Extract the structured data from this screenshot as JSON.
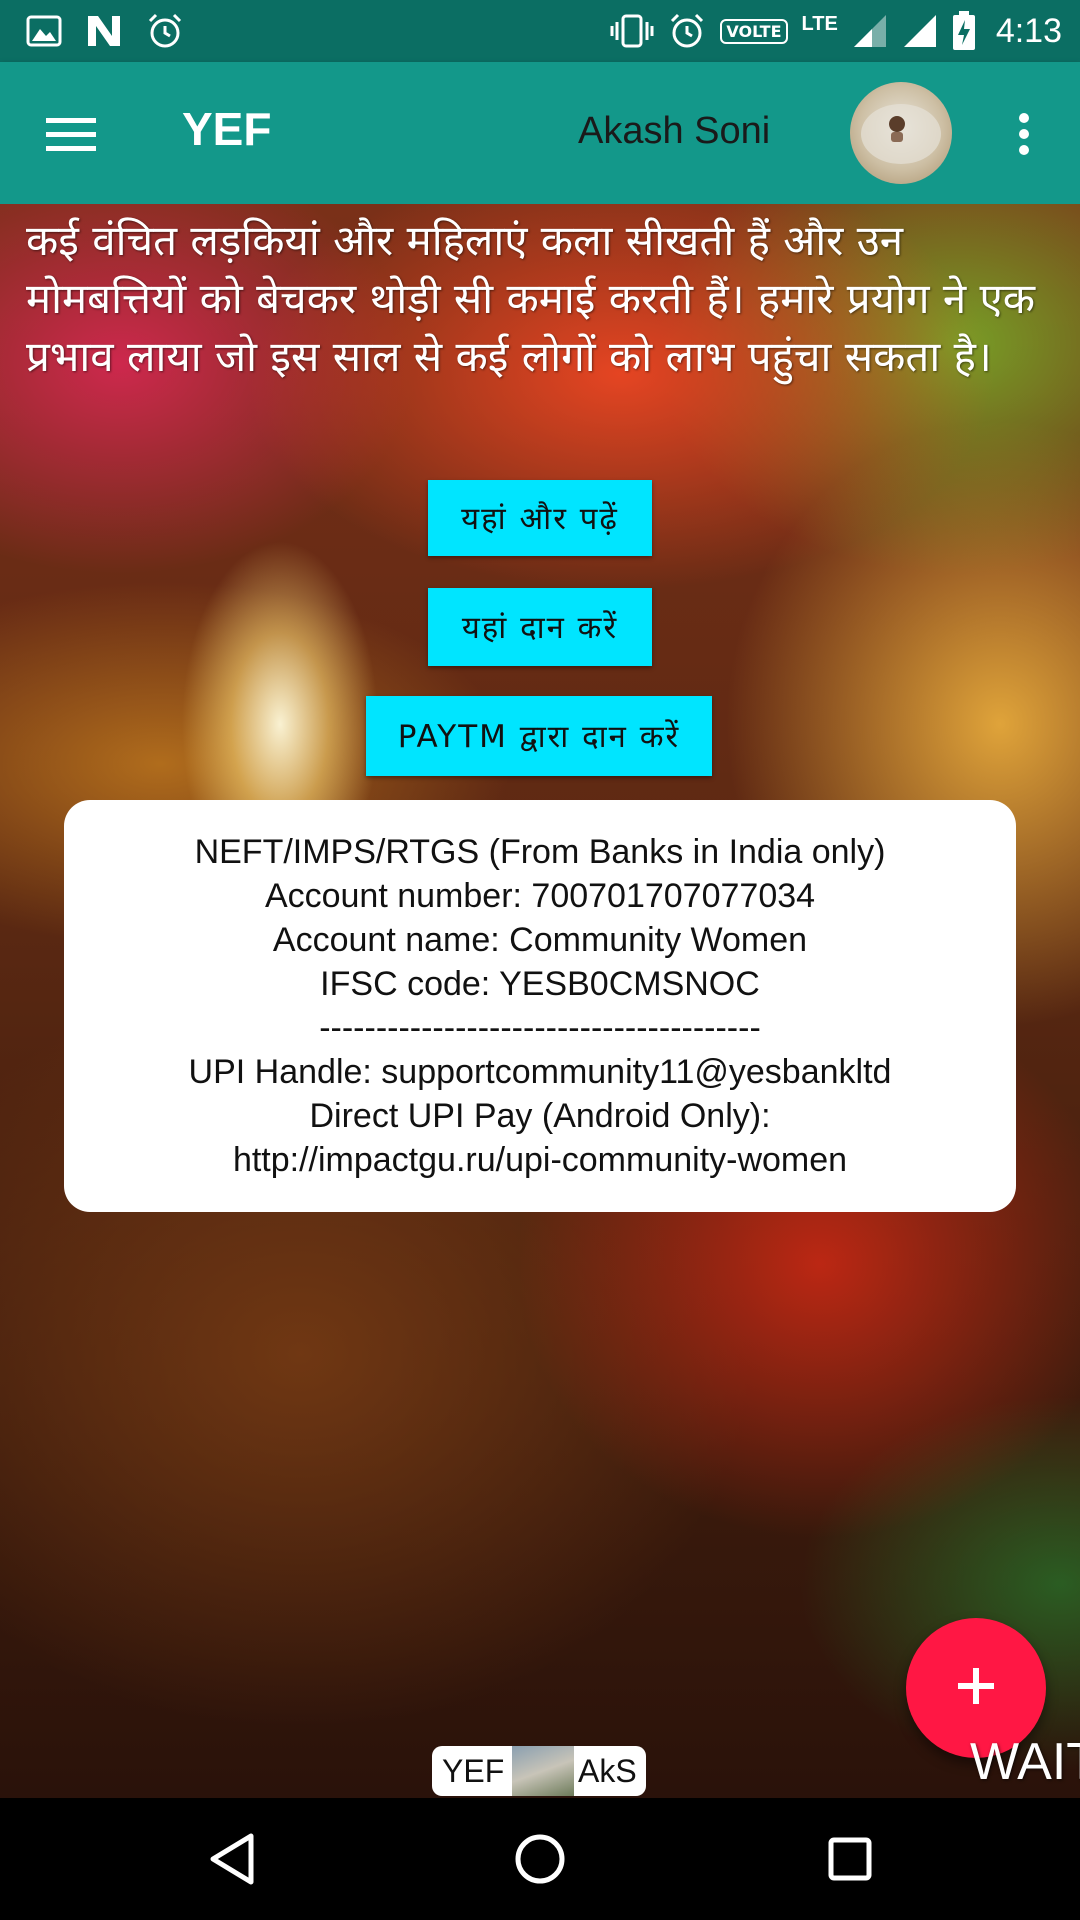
{
  "status_bar": {
    "time": "4:13",
    "volte": "VOLTE",
    "network": "LTE",
    "left_icons": [
      "image-icon",
      "n-app-icon",
      "alarm-icon"
    ],
    "right_icons": [
      "vibrate-icon",
      "alarm-icon",
      "volte-icon",
      "signal-icon",
      "signal-icon",
      "battery-charging-icon"
    ]
  },
  "app_bar": {
    "title": "YEF",
    "user_name": "Akash Soni",
    "menu_icon": "hamburger-menu-icon",
    "overflow_icon": "more-vert-icon"
  },
  "main": {
    "description": "कई वंचित लड़कियां और महिलाएं कला सीखती हैं और उन मोमबत्तियों को बेचकर थोड़ी सी कमाई करती हैं। हमारे प्रयोग ने एक प्रभाव लाया जो इस साल से कई लोगों को लाभ पहुंचा सकता है।",
    "buttons": {
      "read_more": "यहां और पढ़ें",
      "donate_here": "यहां दान करें",
      "donate_paytm": "PAYTM द्वारा दान करें"
    },
    "bank_info": {
      "line1": "NEFT/IMPS/RTGS (From Banks in India only)",
      "line2": "Account number: 700701707077034",
      "line3": "Account name: Community Women",
      "line4": "IFSC code: YESB0CMSNOC",
      "divider": "---------------------------------------",
      "line5": "UPI Handle: supportcommunity11@yesbankltd",
      "line6": "Direct UPI Pay (Android Only):",
      "line7": "http://impactgu.ru/upi-community-women"
    },
    "fab_icon": "plus-icon",
    "badge_left": "YEF",
    "badge_right": "AkS",
    "wait_text": "WAIT"
  },
  "colors": {
    "status_bar": "#0b6e63",
    "app_bar": "#13988a",
    "button": "#00e5ff",
    "fab": "#ff1744"
  }
}
